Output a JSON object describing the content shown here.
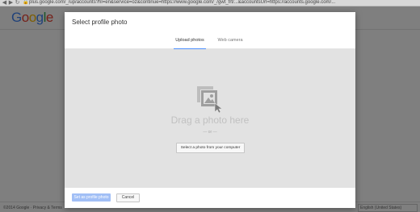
{
  "browser": {
    "url": "plus.google.com/_/up/accounts?hl=en&service=oz&continue=https://www.google.com/_/gwt_frt/...&accountsUrl=https://accounts.google.com/..."
  },
  "background": {
    "logo": [
      "G",
      "o",
      "o",
      "g",
      "l",
      "e"
    ],
    "footer_copy": "©2014 Google · Privacy & Terms",
    "language": "English (United States)"
  },
  "dialog": {
    "title": "Select profile photo",
    "tabs": [
      "Upload photos",
      "Web camera"
    ],
    "drag_text": "Drag a photo here",
    "or_text": "— or —",
    "select_button": "Select a photo from your computer",
    "set_button": "Set as profile photo",
    "cancel_button": "Cancel"
  },
  "colors": {
    "accent": "#4d90fe",
    "primary_disabled": "#a1bff6",
    "dropzone": "#e2e2e2"
  },
  "icons": [
    "back-icon",
    "forward-icon",
    "reload-icon",
    "lock-icon",
    "photo-stack-icon",
    "cursor-icon"
  ]
}
